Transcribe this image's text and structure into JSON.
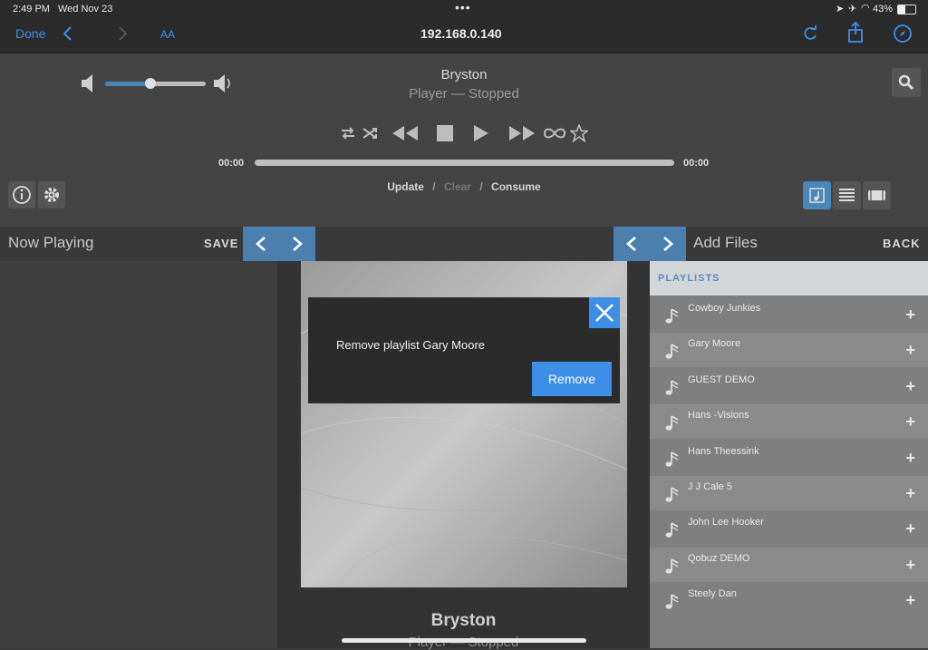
{
  "status_bar": {
    "time": "2:49 PM",
    "date": "Wed Nov 23",
    "battery": "43%"
  },
  "browser": {
    "done": "Done",
    "text_size": "AA",
    "url": "192.168.0.140"
  },
  "player": {
    "title": "Bryston",
    "status": "Player — Stopped",
    "elapsed": "00:00",
    "total": "00:00",
    "volume_level": 0.45,
    "progress": 0,
    "queue_actions": {
      "update": "Update",
      "sep1": "/",
      "clear": "Clear",
      "sep2": "/",
      "consume": "Consume"
    }
  },
  "now_playing": {
    "title": "Now Playing",
    "save": "SAVE"
  },
  "add_files": {
    "title": "Add Files",
    "back": "BACK",
    "section": "PLAYLISTS"
  },
  "playlists": [
    "Cowboy Junkies",
    "Gary Moore",
    "GUEST DEMO",
    "Hans -Visions",
    "Hans Theessink",
    "J J Cale 5",
    "John Lee Hooker",
    "Qobuz DEMO",
    "Steely Dan"
  ],
  "center": {
    "title": "Bryston",
    "status": "Player — Stopped"
  },
  "dialog": {
    "message": "Remove playlist Gary Moore",
    "remove": "Remove"
  },
  "colors": {
    "accent": "#3d8ee6",
    "nav_button": "#4a7fae"
  }
}
